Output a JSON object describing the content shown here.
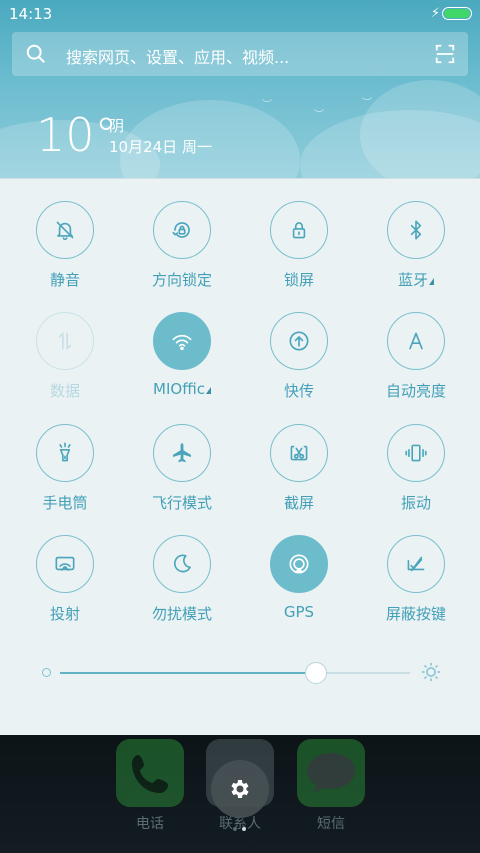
{
  "status": {
    "time": "14:13",
    "charging_icon": "bolt-icon",
    "battery_percent": 100
  },
  "search": {
    "placeholder": "搜索网页、设置、应用、视频...",
    "icon": "search-icon",
    "scan_icon": "scan-icon"
  },
  "weather": {
    "temperature": "10°",
    "condition": "阴",
    "date": "10月24日 周一"
  },
  "toggles": [
    {
      "label": "静音",
      "icon": "mute-bell-icon",
      "state": "off",
      "has_more": false
    },
    {
      "label": "方向锁定",
      "icon": "rotation-lock-icon",
      "state": "off",
      "has_more": false
    },
    {
      "label": "锁屏",
      "icon": "lock-icon",
      "state": "off",
      "has_more": false
    },
    {
      "label": "蓝牙",
      "icon": "bluetooth-icon",
      "state": "off",
      "has_more": true
    },
    {
      "label": "数据",
      "icon": "mobile-data-icon",
      "state": "disabled",
      "has_more": false
    },
    {
      "label": "MIOffic",
      "icon": "wifi-icon",
      "state": "on",
      "has_more": true
    },
    {
      "label": "快传",
      "icon": "quick-transfer-icon",
      "state": "off",
      "has_more": false
    },
    {
      "label": "自动亮度",
      "icon": "auto-brightness-icon",
      "state": "off",
      "has_more": false
    },
    {
      "label": "手电筒",
      "icon": "flashlight-icon",
      "state": "off",
      "has_more": false
    },
    {
      "label": "飞行模式",
      "icon": "airplane-icon",
      "state": "off",
      "has_more": false
    },
    {
      "label": "截屏",
      "icon": "screenshot-icon",
      "state": "off",
      "has_more": false
    },
    {
      "label": "振动",
      "icon": "vibrate-icon",
      "state": "off",
      "has_more": false
    },
    {
      "label": "投射",
      "icon": "cast-icon",
      "state": "off",
      "has_more": false
    },
    {
      "label": "勿扰模式",
      "icon": "moon-icon",
      "state": "off",
      "has_more": false
    },
    {
      "label": "GPS",
      "icon": "gps-icon",
      "state": "on",
      "has_more": false
    },
    {
      "label": "屏蔽按键",
      "icon": "block-keys-icon",
      "state": "off",
      "has_more": false
    }
  ],
  "brightness": {
    "level": 0.73,
    "low_icon": "brightness-low-icon",
    "high_icon": "brightness-high-icon"
  },
  "dock": {
    "apps": [
      {
        "label": "电话",
        "icon": "phone-icon",
        "color": "#2f9c3c"
      },
      {
        "label": "联系人",
        "icon": "contacts-icon",
        "color": "#5a6a70"
      },
      {
        "label": "短信",
        "icon": "message-icon",
        "color": "#2f9c3c"
      }
    ],
    "settings_icon": "gear-icon"
  },
  "colors": {
    "accent": "#6dbccc",
    "label": "#43a0b7",
    "panel_bg": "#ebf2f4"
  }
}
